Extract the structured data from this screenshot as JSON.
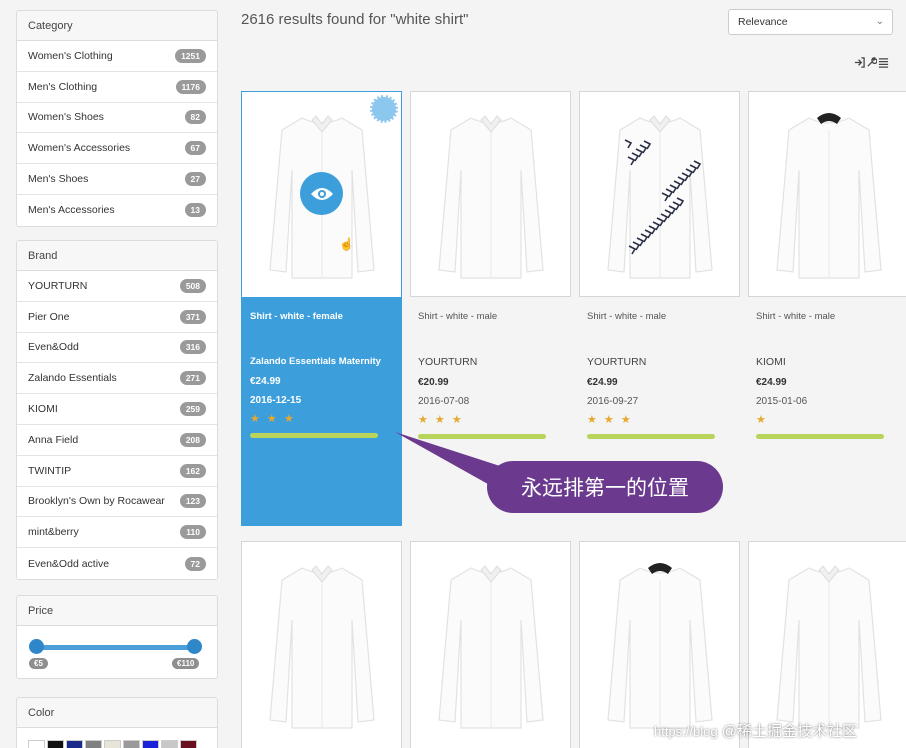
{
  "category": {
    "header": "Category",
    "items": [
      {
        "label": "Women's Clothing",
        "count": "1251"
      },
      {
        "label": "Men's Clothing",
        "count": "1176"
      },
      {
        "label": "Women's Shoes",
        "count": "82"
      },
      {
        "label": "Women's Accessories",
        "count": "67"
      },
      {
        "label": "Men's Shoes",
        "count": "27"
      },
      {
        "label": "Men's Accessories",
        "count": "13"
      }
    ]
  },
  "brand": {
    "header": "Brand",
    "items": [
      {
        "label": "YOURTURN",
        "count": "508"
      },
      {
        "label": "Pier One",
        "count": "371"
      },
      {
        "label": "Even&Odd",
        "count": "316"
      },
      {
        "label": "Zalando Essentials",
        "count": "271"
      },
      {
        "label": "KIOMI",
        "count": "259"
      },
      {
        "label": "Anna Field",
        "count": "208"
      },
      {
        "label": "TWINTIP",
        "count": "162"
      },
      {
        "label": "Brooklyn's Own by Rocawear",
        "count": "123"
      },
      {
        "label": "mint&berry",
        "count": "110"
      },
      {
        "label": "Even&Odd active",
        "count": "72"
      }
    ]
  },
  "price": {
    "header": "Price",
    "min_label": "€5",
    "max_label": "€110",
    "range_low": 0,
    "range_high": 1
  },
  "color": {
    "header": "Color",
    "swatches": [
      "#ffffff",
      "#111111",
      "#1a2a8a",
      "#808080",
      "#e8e4d8",
      "#9a9a9a",
      "#1b22d8",
      "#c8c8c8",
      "#6a1020"
    ]
  },
  "search": {
    "results_text": "2616 results found for \"white shirt\"",
    "sort_value": "Relevance"
  },
  "toolbar": {
    "icons": [
      "sign-in-icon",
      "wrench-icon",
      "list-icon"
    ]
  },
  "products": [
    {
      "title": "Shirt - white - female",
      "brand": "Zalando Essentials Maternity",
      "price": "€24.99",
      "date": "2016-12-15",
      "stars": "★ ★ ★",
      "rating": 3,
      "featured": true,
      "pattern": "plain"
    },
    {
      "title": "Shirt - white - male",
      "brand": "YOURTURN",
      "price": "€20.99",
      "date": "2016-07-08",
      "stars": "★ ★ ★",
      "rating": 3,
      "featured": false,
      "pattern": "plain"
    },
    {
      "title": "Shirt - white - male",
      "brand": "YOURTURN",
      "price": "€24.99",
      "date": "2016-09-27",
      "stars": "★ ★ ★",
      "rating": 3,
      "featured": false,
      "pattern": "print"
    },
    {
      "title": "Shirt - white - male",
      "brand": "KIOMI",
      "price": "€24.99",
      "date": "2015-01-06",
      "stars": "★",
      "rating": 1,
      "featured": false,
      "pattern": "dark-collar"
    }
  ],
  "callout": {
    "text": "永远排第一的位置"
  },
  "watermark": {
    "url": "https://blog",
    "text": "@稀土掘金技术社区"
  },
  "colors": {
    "accent": "#3c9fdc",
    "callout": "#6b3a8e",
    "rating_bar": "#b8d45a",
    "star": "#e8a72d"
  }
}
